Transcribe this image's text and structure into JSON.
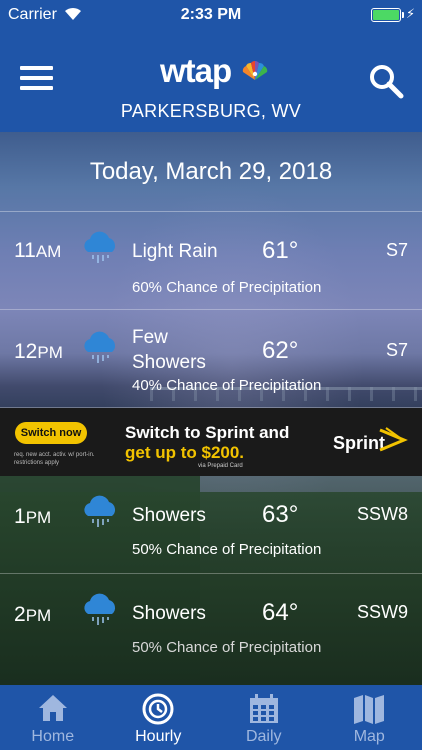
{
  "status_bar": {
    "carrier": "Carrier",
    "time": "2:33 PM",
    "battery_level": 1.0,
    "bolt_icon": "⚡"
  },
  "header": {
    "logo_text": "wtap",
    "location": "PARKERSBURG, WV"
  },
  "date_label": "Today, March 29, 2018",
  "hours": [
    {
      "hour": "11",
      "ampm": "AM",
      "icon": "rain-cloud-icon",
      "condition": "Light Rain",
      "temp": "61°",
      "wind": "S7",
      "precip": "60% Chance of Precipitation"
    },
    {
      "hour": "12",
      "ampm": "PM",
      "icon": "rain-cloud-icon",
      "condition": "Few Showers",
      "temp": "62°",
      "wind": "S7",
      "precip": "40% Chance of Precipitation"
    },
    {
      "hour": "1",
      "ampm": "PM",
      "icon": "rain-cloud-icon",
      "condition": "Showers",
      "temp": "63°",
      "wind": "SSW8",
      "precip": "50% Chance of Precipitation"
    },
    {
      "hour": "2",
      "ampm": "PM",
      "icon": "rain-cloud-icon",
      "condition": "Showers",
      "temp": "64°",
      "wind": "SSW9",
      "precip": "50% Chance of Precipitation"
    }
  ],
  "ad": {
    "cta": "Switch now",
    "fine_print": "req. new acct. activ. w/ port-in. restrictions apply",
    "headline_1": "Switch to Sprint and",
    "headline_2": "get up to $200.",
    "sub": "via Prepaid Card",
    "brand": "Sprint"
  },
  "tabs": [
    {
      "label": "Home",
      "icon": "home-icon",
      "active": false
    },
    {
      "label": "Hourly",
      "icon": "clock-icon",
      "active": true
    },
    {
      "label": "Daily",
      "icon": "calendar-icon",
      "active": false
    },
    {
      "label": "Map",
      "icon": "map-icon",
      "active": false
    }
  ],
  "colors": {
    "header_blue": "#1f55a8",
    "tab_inactive": "#9fb7df",
    "battery_green": "#4cd964",
    "ad_yellow": "#f2c300"
  }
}
